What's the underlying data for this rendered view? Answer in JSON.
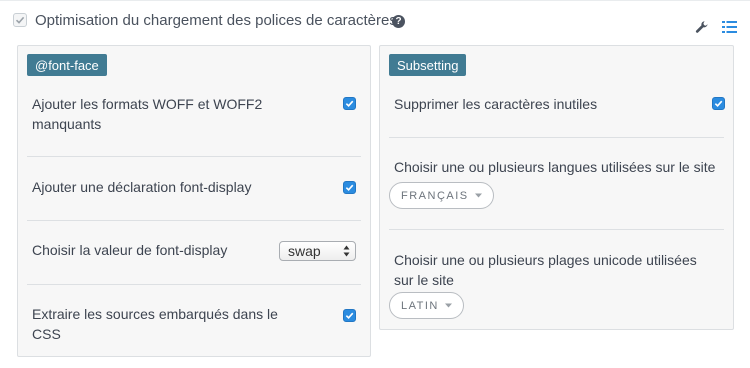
{
  "header": {
    "title": "Optimisation du chargement des polices de caractères",
    "help_icon_glyph": "?",
    "enabled": true
  },
  "icons": {
    "tools": "wrench-icon",
    "list": "list-icon",
    "accent": "#2b8ce0",
    "badge_color": "#417b93"
  },
  "font_face": {
    "badge": "@font-face",
    "woff_label_line1": "Ajouter les formats WOFF et WOFF2",
    "woff_label_line2": "manquants",
    "woff_checked": true,
    "font_display_label": "Ajouter une déclaration font-display",
    "font_display_checked": true,
    "font_display_value_label": "Choisir la valeur de font-display",
    "font_display_value": "swap",
    "extract_label_line1": "Extraire les sources embarqués dans le",
    "extract_label_line2": "CSS",
    "extract_checked": true
  },
  "subsetting": {
    "badge": "Subsetting",
    "remove_chars_label": "Supprimer les caractères inutiles",
    "remove_chars_checked": true,
    "languages_label": "Choisir une ou plusieurs langues utilisées sur le site",
    "languages_value": "FRANÇAIS",
    "unicode_label_line1": "Choisir une ou plusieurs plages unicode utilisées",
    "unicode_label_line2": "sur le site",
    "unicode_value": "LATIN"
  }
}
